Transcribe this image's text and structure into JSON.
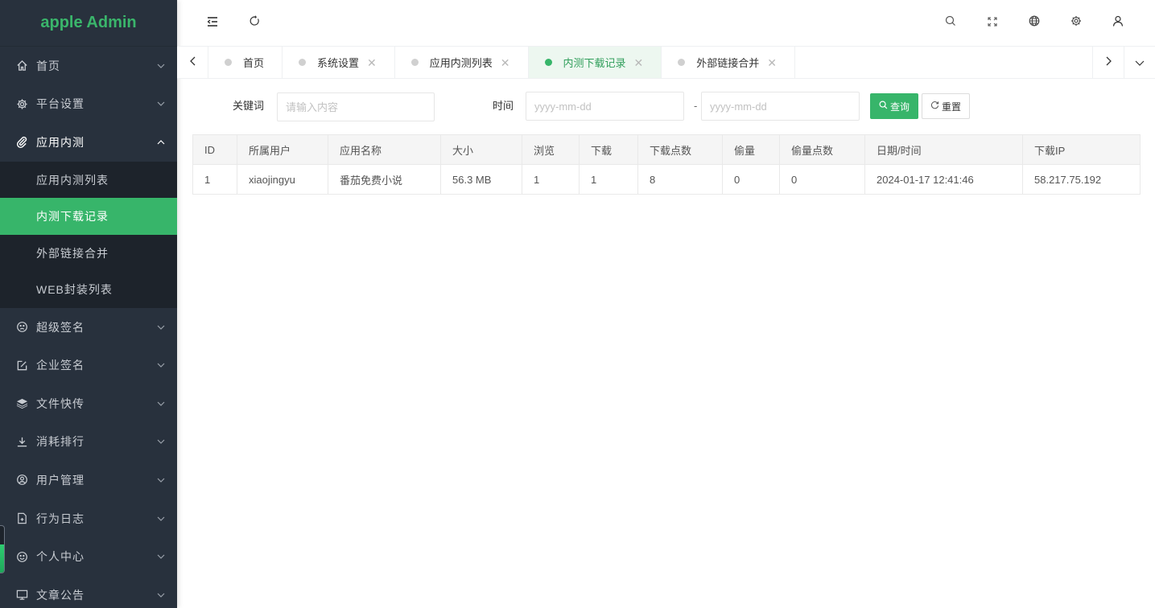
{
  "app": {
    "title": "apple Admin",
    "accent": "#37b56a",
    "sidebar_bg": "#28313d"
  },
  "sidebar": {
    "items": [
      {
        "label": "首页",
        "icon": "home-icon",
        "expanded": false
      },
      {
        "label": "平台设置",
        "icon": "gear-icon",
        "expanded": false
      },
      {
        "label": "应用内测",
        "icon": "paperclip-icon",
        "expanded": true,
        "children": [
          {
            "label": "应用内测列表",
            "active": false
          },
          {
            "label": "内测下载记录",
            "active": true
          },
          {
            "label": "外部链接合并",
            "active": false
          },
          {
            "label": "WEB封装列表",
            "active": false
          }
        ]
      },
      {
        "label": "超级签名",
        "icon": "sad-face-icon",
        "expanded": false
      },
      {
        "label": "企业签名",
        "icon": "edit-icon",
        "expanded": false
      },
      {
        "label": "文件快传",
        "icon": "layers-icon",
        "expanded": false
      },
      {
        "label": "消耗排行",
        "icon": "download-icon",
        "expanded": false
      },
      {
        "label": "用户管理",
        "icon": "user-circle-icon",
        "expanded": false
      },
      {
        "label": "行为日志",
        "icon": "file-add-icon",
        "expanded": false
      },
      {
        "label": "个人中心",
        "icon": "smile-face-icon",
        "expanded": false
      },
      {
        "label": "文章公告",
        "icon": "monitor-icon",
        "expanded": false
      }
    ]
  },
  "header": {
    "left_icons": [
      "menu-fold-icon",
      "refresh-icon"
    ],
    "right_icons": [
      "search-icon",
      "fullscreen-icon",
      "globe-icon",
      "gear-icon",
      "user-icon"
    ]
  },
  "tabs": [
    {
      "label": "首页",
      "closable": false,
      "active": false
    },
    {
      "label": "系统设置",
      "closable": true,
      "active": false
    },
    {
      "label": "应用内测列表",
      "closable": true,
      "active": false
    },
    {
      "label": "内测下载记录",
      "closable": true,
      "active": true
    },
    {
      "label": "外部链接合并",
      "closable": true,
      "active": false
    }
  ],
  "filter": {
    "keyword_label": "关键词",
    "keyword_placeholder": "请输入内容",
    "keyword_value": "",
    "time_label": "时间",
    "start_placeholder": "yyyy-mm-dd",
    "end_placeholder": "yyyy-mm-dd",
    "dash": "-",
    "search_label": "查询",
    "reset_label": "重置"
  },
  "table": {
    "headers": [
      "ID",
      "所属用户",
      "应用名称",
      "大小",
      "浏览",
      "下载",
      "下载点数",
      "偷量",
      "偷量点数",
      "日期/时间",
      "下载IP"
    ],
    "rows": [
      [
        "1",
        "xiaojingyu",
        "番茄免费小说",
        "56.3 MB",
        "1",
        "1",
        "8",
        "0",
        "0",
        "2024-01-17 12:41:46",
        "58.217.75.192"
      ]
    ]
  }
}
